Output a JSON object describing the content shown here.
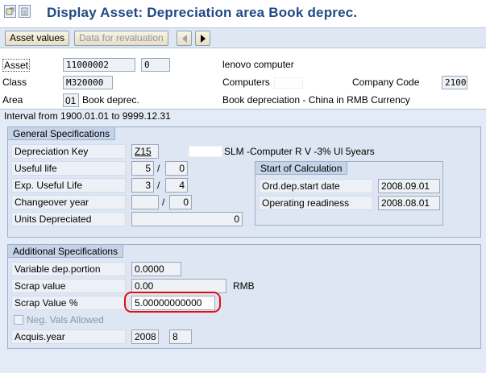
{
  "window": {
    "title": "Display Asset: Depreciation area Book deprec."
  },
  "toolbar": {
    "asset_values": "Asset values",
    "data_revaluation": "Data for revaluation"
  },
  "header": {
    "asset_label": "Asset",
    "asset_number": "11000002",
    "asset_sub": "0",
    "asset_desc": "lenovo computer",
    "class_label": "Class",
    "class_value": "M320000",
    "class_desc": "Computers",
    "company_code_label": "Company Code",
    "company_code_value": "2100",
    "area_label": "Area",
    "area_value": "01",
    "area_name": "Book deprec.",
    "area_desc": "Book depreciation - China in RMB Currency"
  },
  "interval": "Interval from 1900.01.01 to 9999.12.31",
  "general": {
    "title": "General Specifications",
    "dep_key_label": "Depreciation Key",
    "dep_key_value": "Z15",
    "dep_key_desc": "SLM -Computer R V -3% Ul 5years",
    "useful_life_label": "Useful life",
    "useful_life_years": "5",
    "useful_life_periods": "0",
    "exp_life_label": "Exp. Useful Life",
    "exp_life_years": "3",
    "exp_life_periods": "4",
    "changeover_label": "Changeover year",
    "changeover_periods": "0",
    "units_label": "Units Depreciated",
    "units_value": "0",
    "slash": "/"
  },
  "start_calc": {
    "title": "Start of Calculation",
    "ord_dep_label": "Ord.dep.start date",
    "ord_dep_value": "2008.09.01",
    "op_ready_label": "Operating readiness",
    "op_ready_value": "2008.08.01"
  },
  "additional": {
    "title": "Additional Specifications",
    "variable_label": "Variable dep.portion",
    "variable_value": "0.0000",
    "scrap_value_label": "Scrap value",
    "scrap_value_value": "0.00",
    "currency": "RMB",
    "scrap_pct_label": "Scrap Value %",
    "scrap_pct_value": "5.00000000000",
    "neg_vals_label": "Neg. Vals Allowed",
    "acquis_label": "Acquis.year",
    "acquis_year": "2008",
    "acquis_period": "8"
  },
  "colors": {
    "title": "#1f4a86",
    "highlight": "#e01010"
  }
}
